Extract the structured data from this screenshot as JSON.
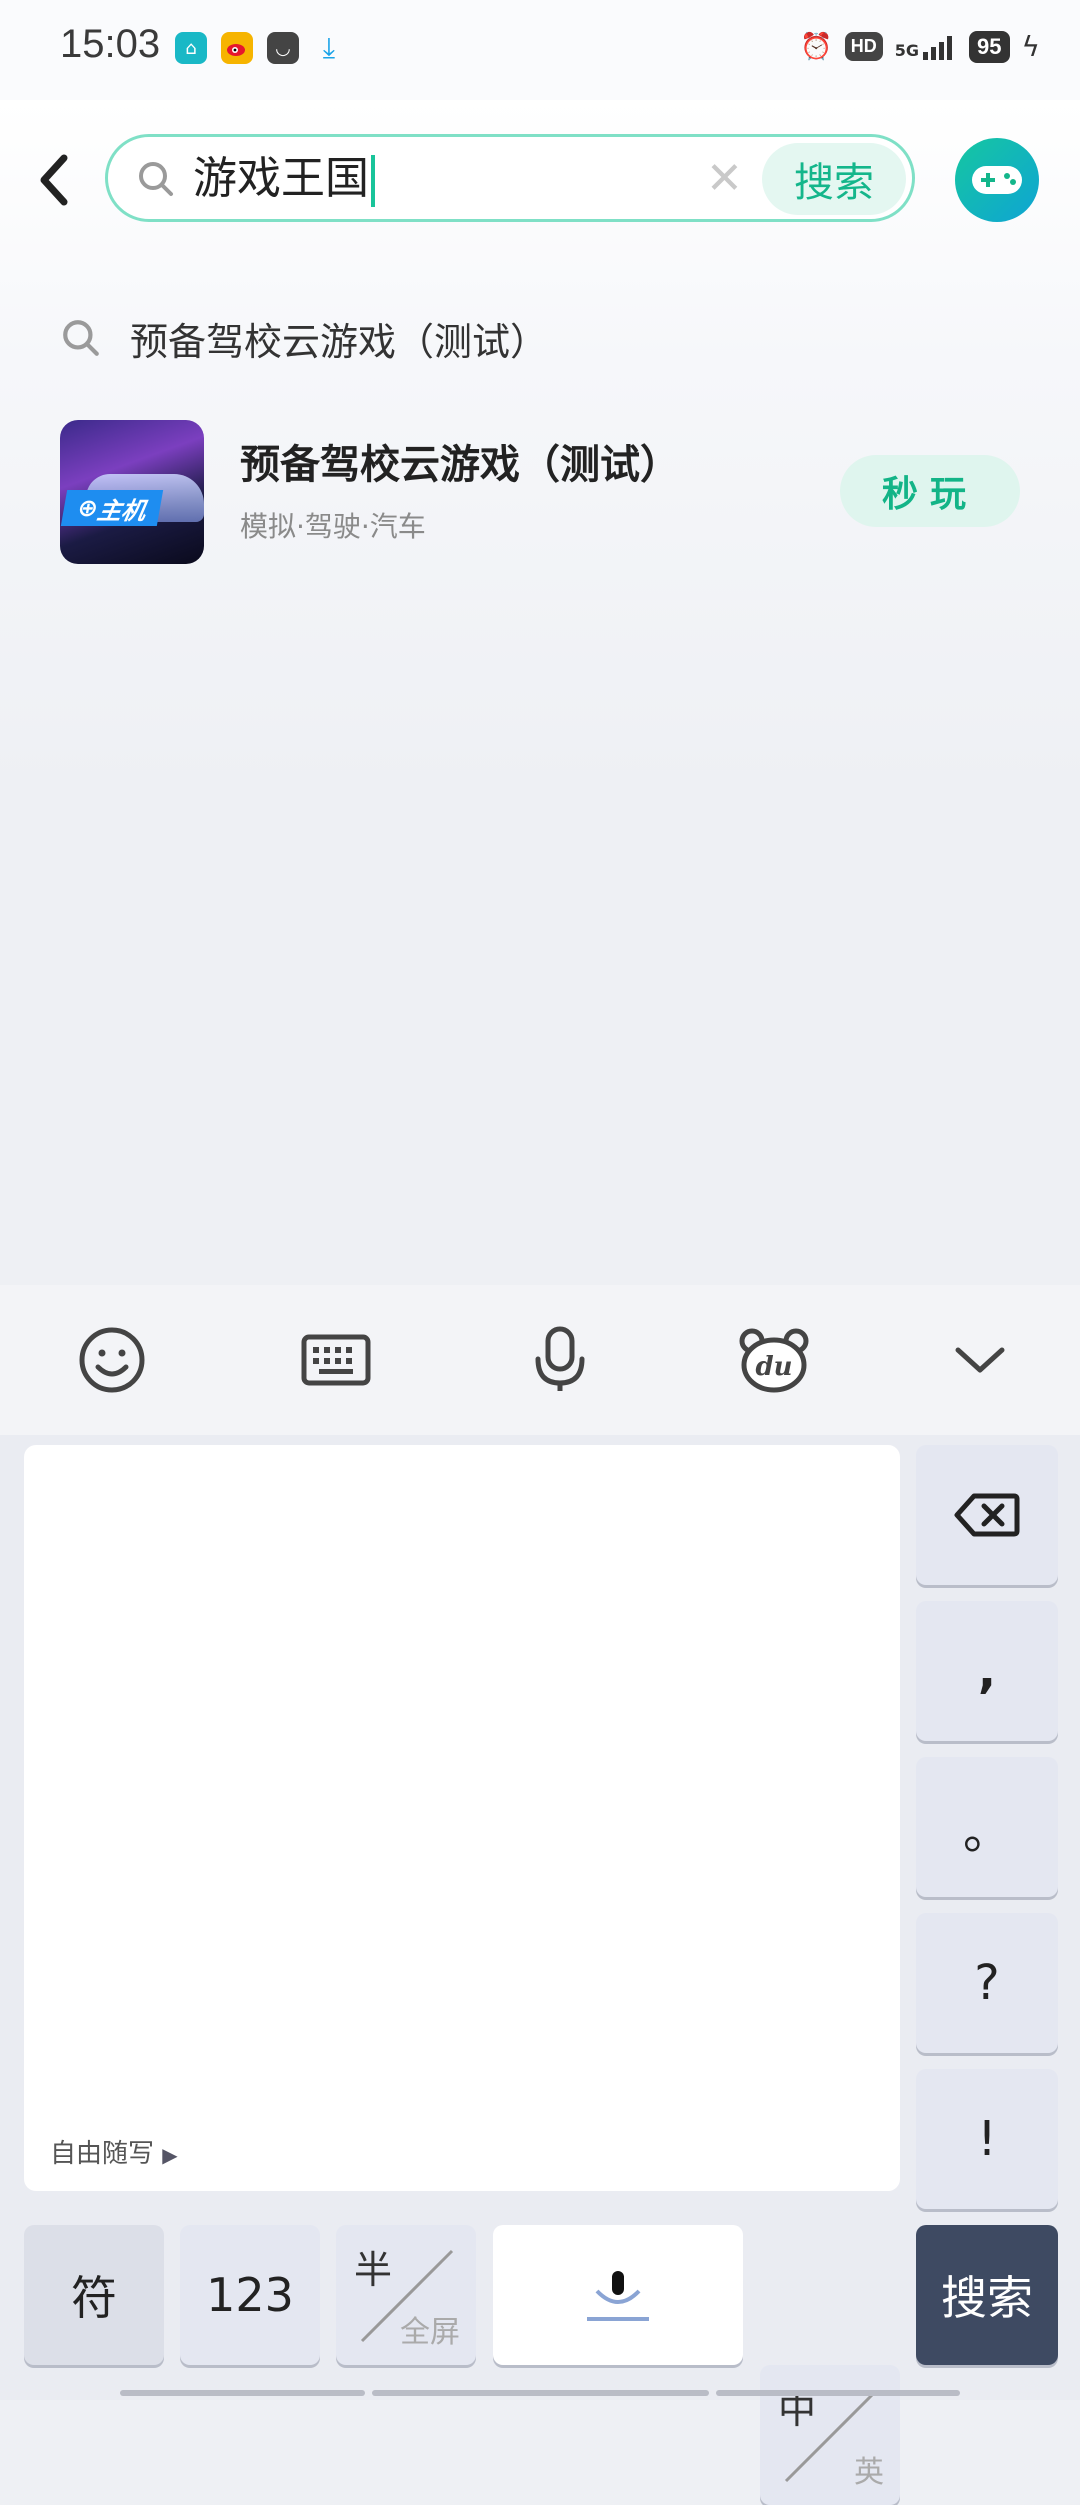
{
  "status_bar": {
    "time": "15:03",
    "battery": "95",
    "network": "5G",
    "hd_label": "HD",
    "left_icons": [
      "home-app-icon",
      "weibo-icon",
      "bag-icon",
      "download-icon"
    ],
    "right_icons": [
      "alarm-icon",
      "hd-icon",
      "signal-5g-icon",
      "battery-icon",
      "charging-icon"
    ]
  },
  "header": {
    "search_query": "游戏王国",
    "search_button": "搜索",
    "clear_symbol": "✕",
    "back_icon": "back-arrow-icon",
    "game_center_icon": "gamepad-icon"
  },
  "suggestion": {
    "text": "预备驾校云游戏（测试）"
  },
  "result": {
    "title": "预备驾校云游戏（测试）",
    "tags": "模拟·驾驶·汽车",
    "icon_badge": "主机",
    "play_button": "秒玩"
  },
  "keyboard": {
    "toolbar_icons": [
      "emoji-icon",
      "keyboard-icon",
      "microphone-icon",
      "du-bear-icon",
      "collapse-chevron-icon"
    ],
    "handwrite_hint": "自由随写",
    "side_keys": [
      ",",
      "。",
      "?",
      "!"
    ],
    "symbol_key": "符",
    "number_key": "123",
    "half_full": {
      "top": "半",
      "bottom": "全屏"
    },
    "lang_switch": {
      "top": "中",
      "bottom": "英"
    },
    "search_key": "搜索"
  },
  "colors": {
    "accent": "#19c49a",
    "search_border": "#7fe0c6",
    "play_bg": "#dff5ee",
    "search_key_bg": "#3e4a62"
  }
}
